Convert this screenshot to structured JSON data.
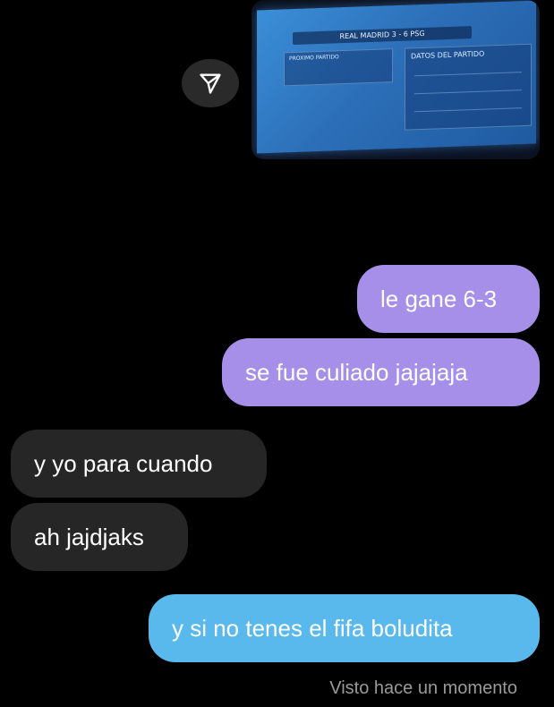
{
  "shared_photo": {
    "home_team": "REAL MADRID",
    "home_score": "3",
    "away_score": "6",
    "away_team": "PSG",
    "stats_title": "DATOS DEL PARTIDO",
    "next_match_label": "PROXIMO PARTIDO"
  },
  "messages": [
    {
      "text": "le gane 6-3",
      "side": "sent"
    },
    {
      "text": "se fue culiado jajajaja",
      "side": "sent"
    },
    {
      "text": "y yo para cuando",
      "side": "received"
    },
    {
      "text": "ah jajdjaks",
      "side": "received"
    },
    {
      "text": "y si no tenes el fifa boludita",
      "side": "sent"
    }
  ],
  "seen_status": "Visto hace un momento",
  "colors": {
    "sent_purple": "#a58fe8",
    "sent_blue": "#59b8ec",
    "received_bubble": "#262626",
    "background": "#000000"
  }
}
